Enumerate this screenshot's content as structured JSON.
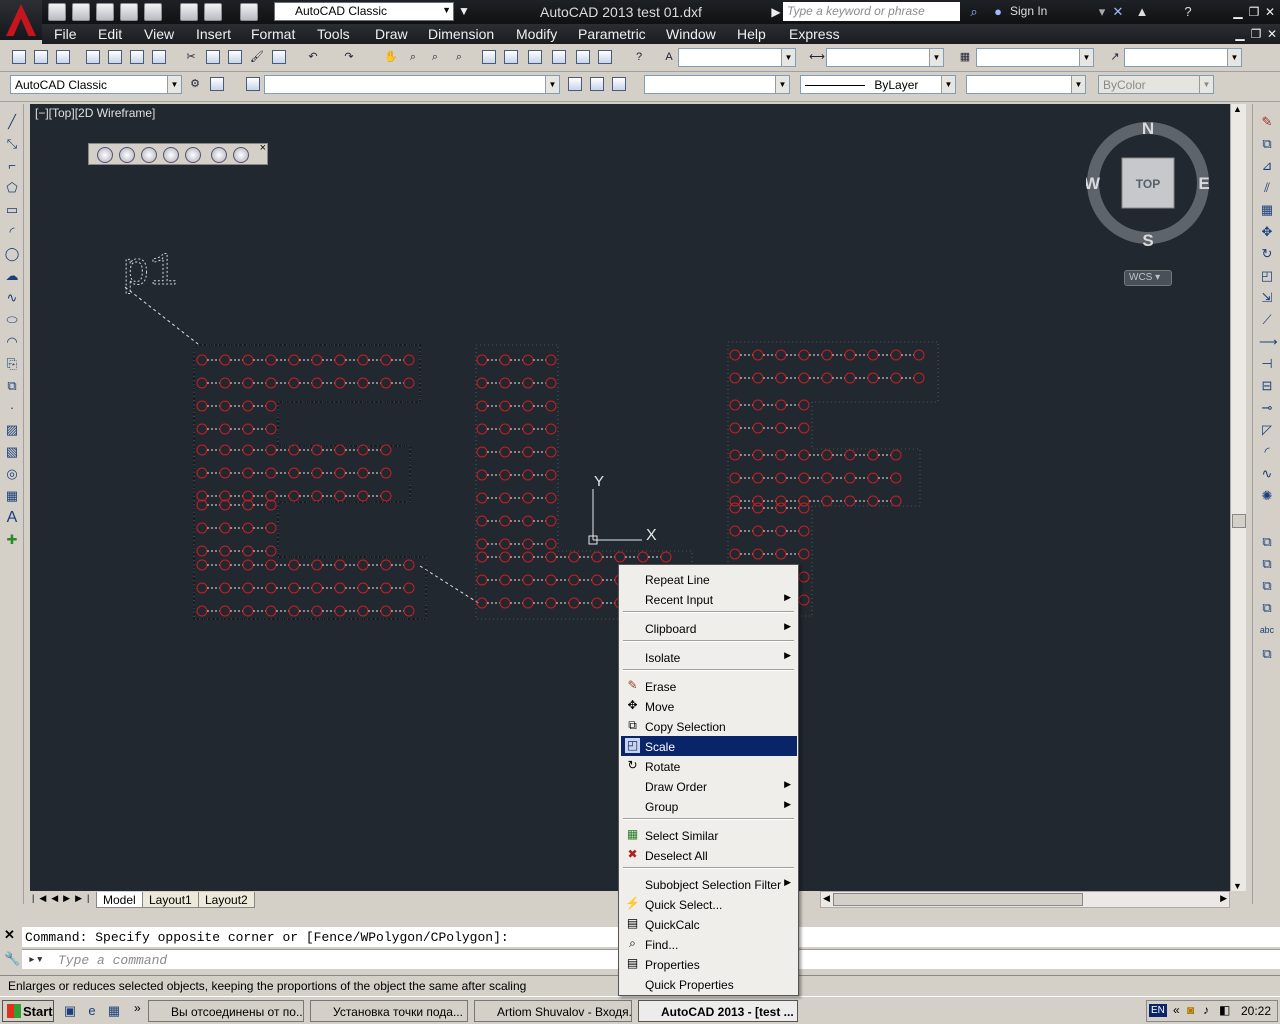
{
  "app": {
    "title": "AutoCAD 2013   test 01.dxf"
  },
  "workspace": {
    "value": "AutoCAD Classic"
  },
  "search": {
    "placeholder": "Type a keyword or phrase"
  },
  "account": {
    "signin_label": "Sign In"
  },
  "menu": [
    "File",
    "Edit",
    "View",
    "Insert",
    "Format",
    "Tools",
    "Draw",
    "Dimension",
    "Modify",
    "Parametric",
    "Window",
    "Help",
    "Express"
  ],
  "props_toolbar": {
    "workspace_combo": "AutoCAD Classic",
    "layer_combo": "",
    "linetype_combo": "ByLayer",
    "color_combo": "ByColor"
  },
  "viewport": {
    "label": "[−][Top][2D Wireframe]",
    "ucs_x": "X",
    "ucs_y": "Y",
    "drawing_text": "p1"
  },
  "viewcube": {
    "n": "N",
    "s": "S",
    "e": "E",
    "w": "W",
    "top": "TOP",
    "wcs": "WCS"
  },
  "layout_tabs": [
    "Model",
    "Layout1",
    "Layout2"
  ],
  "command": {
    "history": "Command: Specify opposite corner or [Fence/WPolygon/CPolygon]:",
    "input_placeholder": "Type a command"
  },
  "status": {
    "text": "Enlarges or reduces selected objects, keeping the proportions of the object the same after scaling"
  },
  "context_menu": {
    "repeat": "Repeat Line",
    "recent": "Recent Input",
    "clipboard": "Clipboard",
    "isolate": "Isolate",
    "erase": "Erase",
    "move": "Move",
    "copy": "Copy Selection",
    "scale": "Scale",
    "rotate": "Rotate",
    "draworder": "Draw Order",
    "group": "Group",
    "selectsimilar": "Select Similar",
    "deselect": "Deselect All",
    "subobject": "Subobject Selection Filter",
    "quickselect": "Quick Select...",
    "quickcalc": "QuickCalc",
    "find": "Find...",
    "properties": "Properties",
    "quickprops": "Quick Properties"
  },
  "taskbar": {
    "start": "Start",
    "tasks": [
      "Вы отсоединены от по...",
      "Установка точки пода...",
      "Artiom Shuvalov - Входя...",
      "AutoCAD 2013 - [test ..."
    ],
    "lang": "EN",
    "clock": "20:22"
  }
}
